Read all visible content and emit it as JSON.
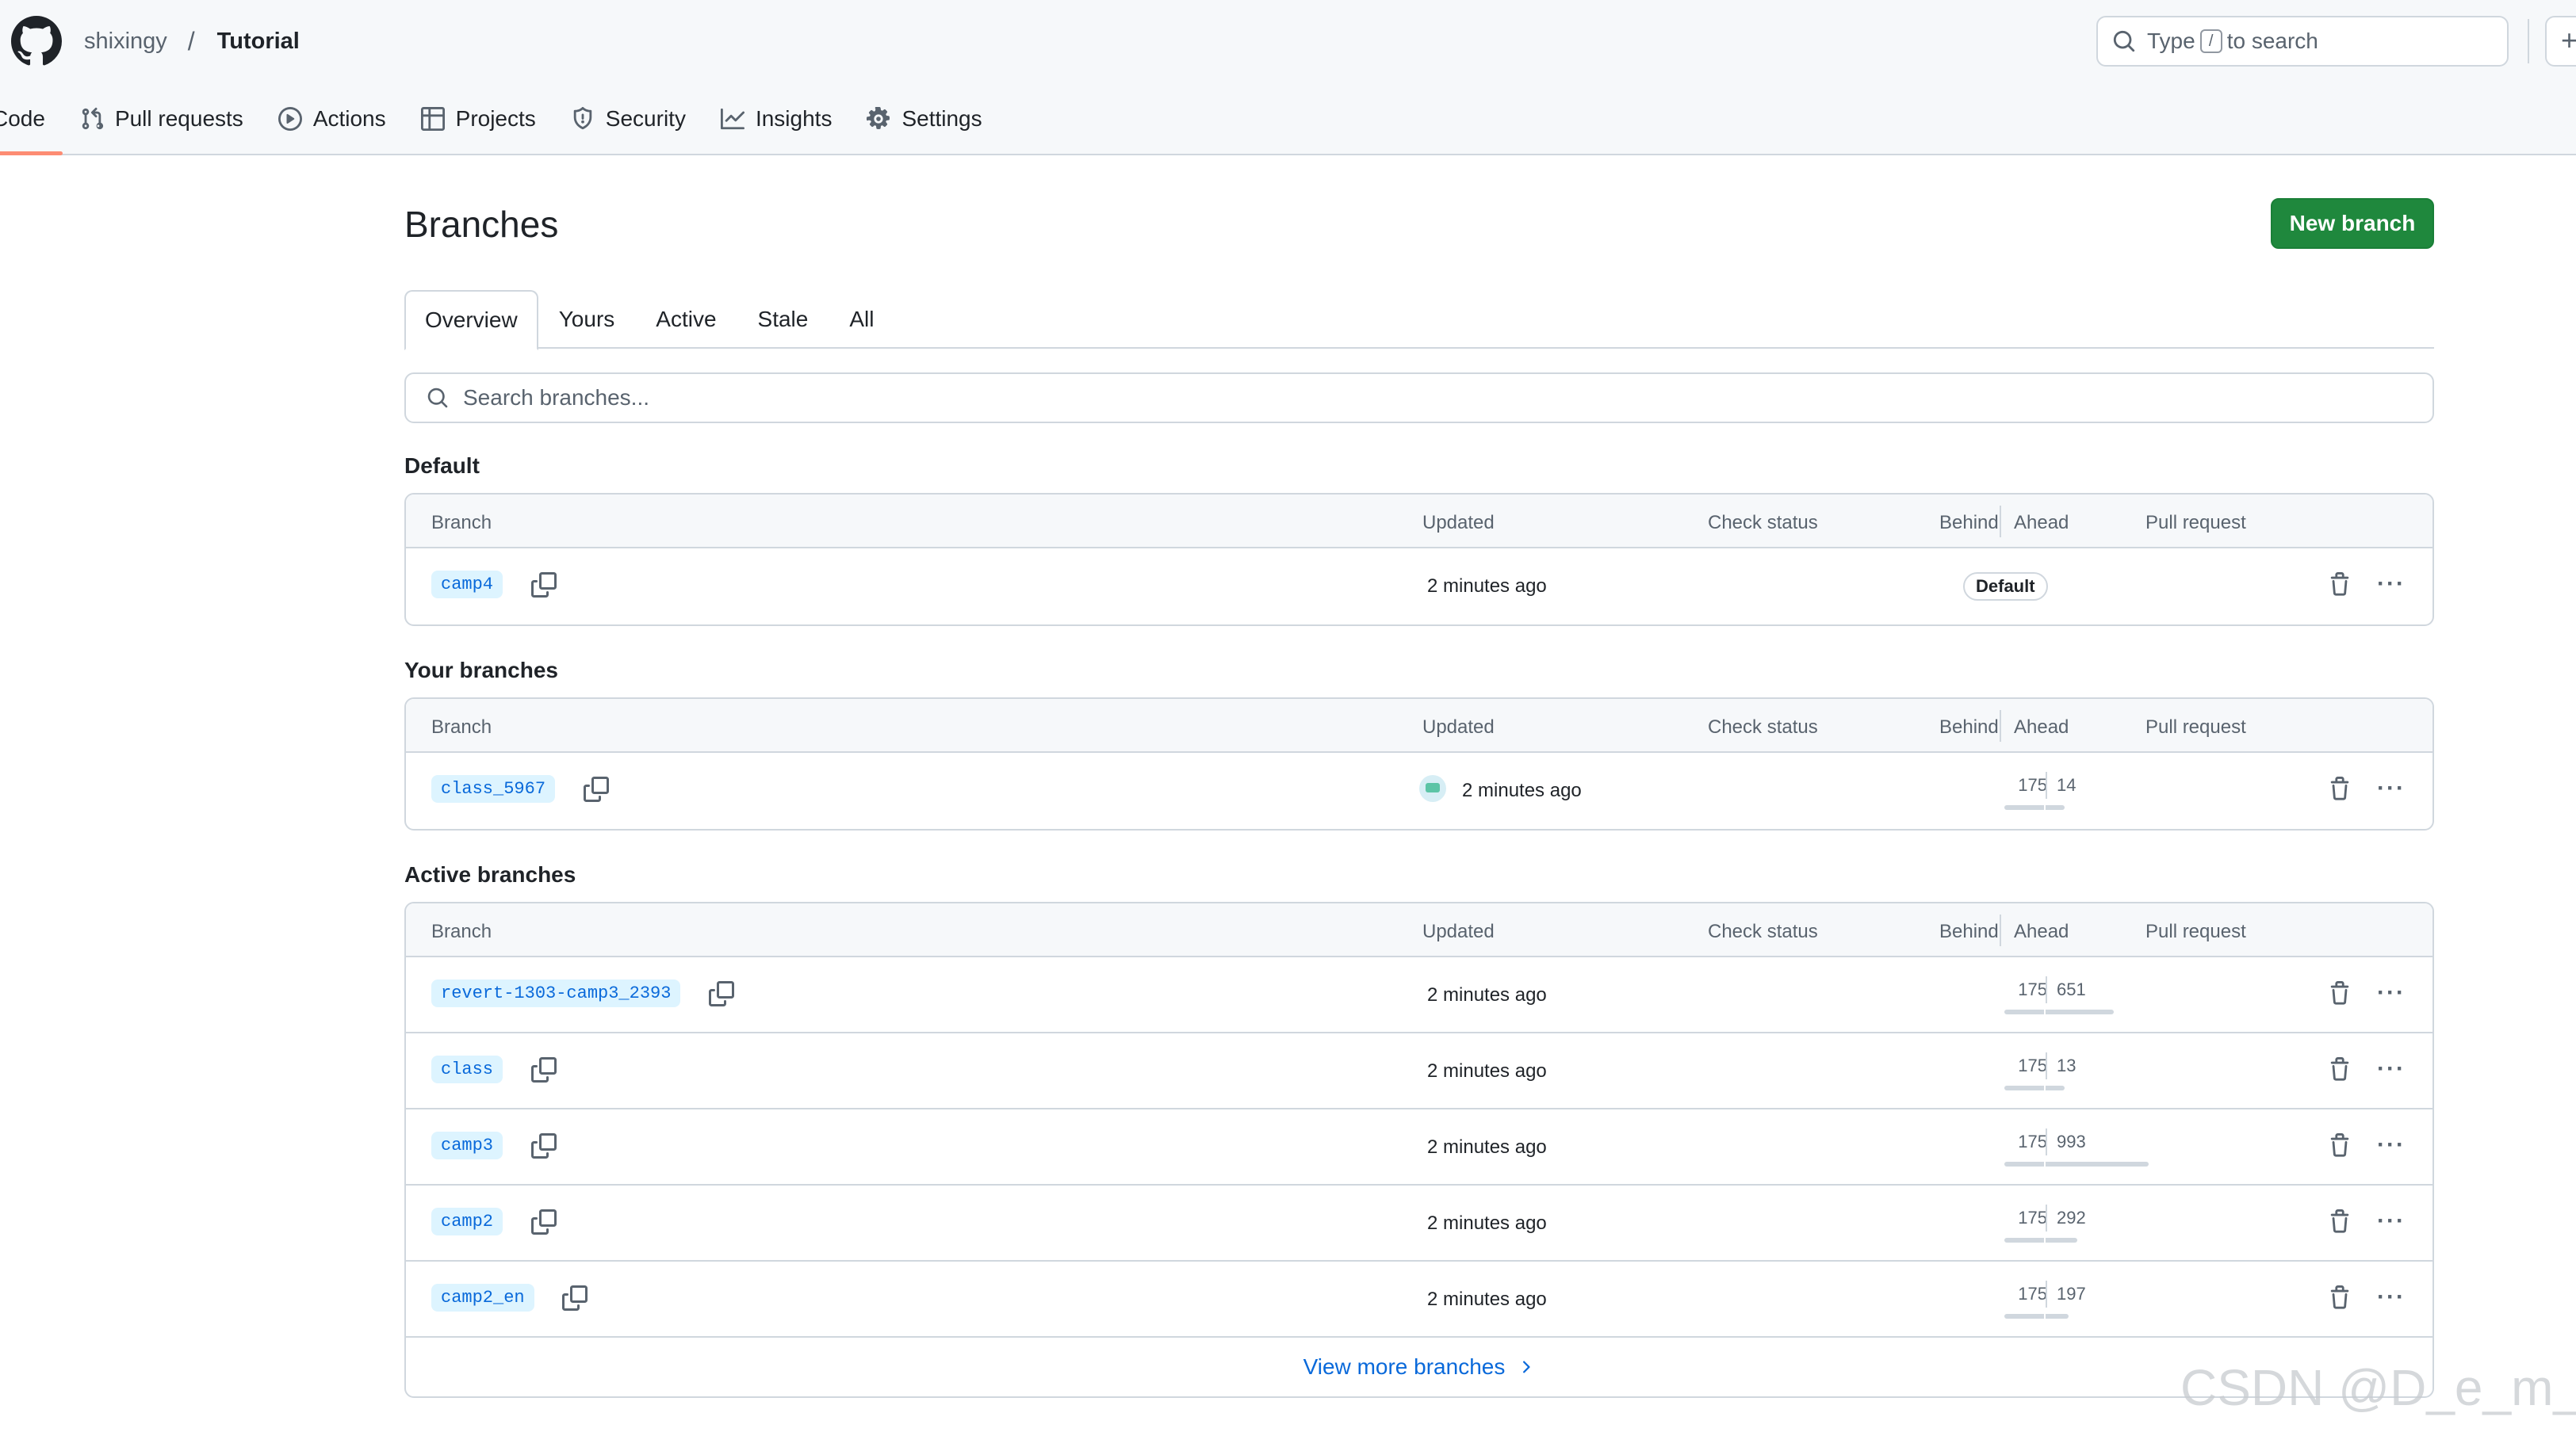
{
  "header": {
    "owner": "shixingy",
    "separator": "/",
    "repo": "Tutorial",
    "search": {
      "prefix": "Type",
      "key": "/",
      "suffix": "to search"
    },
    "plus": "+"
  },
  "repo_tabs": [
    {
      "label": "Code",
      "icon": "code-icon",
      "active": true
    },
    {
      "label": "Pull requests",
      "icon": "git-pull-request-icon"
    },
    {
      "label": "Actions",
      "icon": "play-icon"
    },
    {
      "label": "Projects",
      "icon": "table-icon"
    },
    {
      "label": "Security",
      "icon": "shield-icon"
    },
    {
      "label": "Insights",
      "icon": "graph-icon"
    },
    {
      "label": "Settings",
      "icon": "gear-icon"
    }
  ],
  "page": {
    "title": "Branches",
    "new_branch": "New branch",
    "tabs": [
      "Overview",
      "Yours",
      "Active",
      "Stale",
      "All"
    ],
    "search_placeholder": "Search branches..."
  },
  "columns": {
    "branch": "Branch",
    "updated": "Updated",
    "check_status": "Check status",
    "behind": "Behind",
    "ahead": "Ahead",
    "pull_request": "Pull request"
  },
  "sections": {
    "default": {
      "title": "Default",
      "rows": [
        {
          "name": "camp4",
          "updated": "2 minutes ago",
          "badge": "Default"
        }
      ]
    },
    "yours": {
      "title": "Your branches",
      "rows": [
        {
          "name": "class_5967",
          "updated": "2 minutes ago",
          "behind": "175",
          "ahead": "14",
          "ahead_ratio": 0.07
        }
      ]
    },
    "active": {
      "title": "Active branches",
      "rows": [
        {
          "name": "revert-1303-camp3_2393",
          "updated": "2 minutes ago",
          "behind": "175",
          "ahead": "651",
          "ahead_ratio": 0.66
        },
        {
          "name": "class",
          "updated": "2 minutes ago",
          "behind": "175",
          "ahead": "13",
          "ahead_ratio": 0.05
        },
        {
          "name": "camp3",
          "updated": "2 minutes ago",
          "behind": "175",
          "ahead": "993",
          "ahead_ratio": 1.0
        },
        {
          "name": "camp2",
          "updated": "2 minutes ago",
          "behind": "175",
          "ahead": "292",
          "ahead_ratio": 0.31
        },
        {
          "name": "camp2_en",
          "updated": "2 minutes ago",
          "behind": "175",
          "ahead": "197",
          "ahead_ratio": 0.22
        }
      ],
      "more": "View more branches"
    }
  },
  "watermark": "CSDN @D_e_m_o",
  "colors": {
    "primary_button": "#1f883d",
    "link": "#0969da",
    "active_tab_underline": "#fd8c73",
    "branch_pill_bg": "#ddf4ff"
  }
}
